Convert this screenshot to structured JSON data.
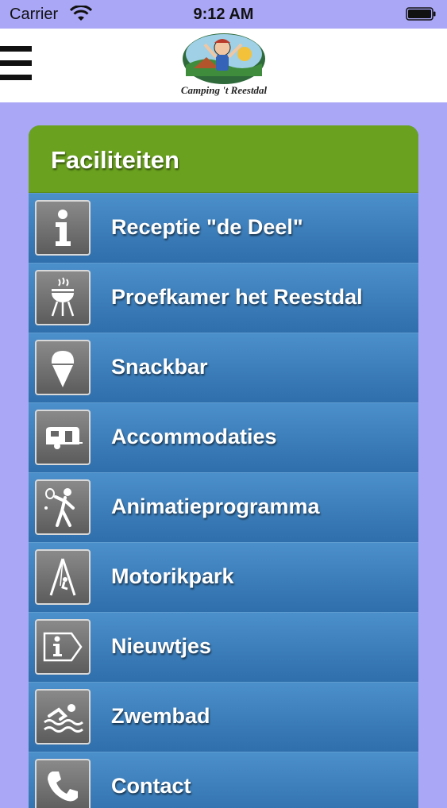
{
  "status": {
    "carrier": "Carrier",
    "time": "9:12 AM"
  },
  "logo": {
    "text": "Camping 't Reestdal"
  },
  "menu": {
    "title": "Faciliteiten",
    "items": [
      {
        "label": "Receptie \"de Deel\"",
        "icon": "info-icon"
      },
      {
        "label": "Proefkamer het Reestdal",
        "icon": "barbecue-icon"
      },
      {
        "label": "Snackbar",
        "icon": "ice-cream-icon"
      },
      {
        "label": "Accommodaties",
        "icon": "caravan-icon"
      },
      {
        "label": "Animatieprogramma",
        "icon": "tennis-player-icon"
      },
      {
        "label": "Motorikpark",
        "icon": "swing-icon"
      },
      {
        "label": "Nieuwtjes",
        "icon": "info-sign-icon"
      },
      {
        "label": "Zwembad",
        "icon": "swimmer-icon"
      },
      {
        "label": "Contact",
        "icon": "phone-icon"
      }
    ]
  },
  "colors": {
    "background": "#aaa7f6",
    "header_green": "#6aa21f",
    "row_blue": "#3f82bf"
  }
}
